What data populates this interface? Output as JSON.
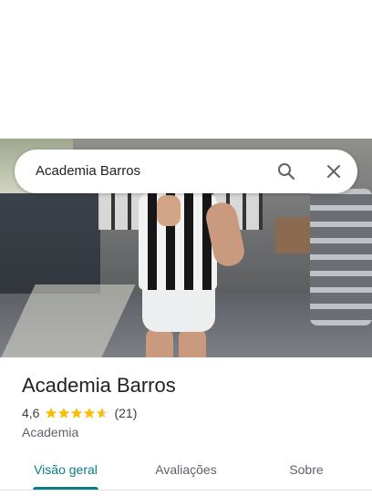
{
  "search": {
    "query": "Academia Barros",
    "search_icon": "search-icon",
    "close_icon": "close-icon"
  },
  "place": {
    "name": "Academia Barros",
    "rating": "4,6",
    "rating_stars_value": 4.6,
    "review_count": "(21)",
    "category": "Academia"
  },
  "tabs": [
    {
      "label": "Visão geral",
      "active": true
    },
    {
      "label": "Avaliações",
      "active": false
    },
    {
      "label": "Sobre",
      "active": false
    }
  ],
  "colors": {
    "accent": "#0b7d86",
    "star": "#fbbc04",
    "star_empty": "#dadce0"
  }
}
